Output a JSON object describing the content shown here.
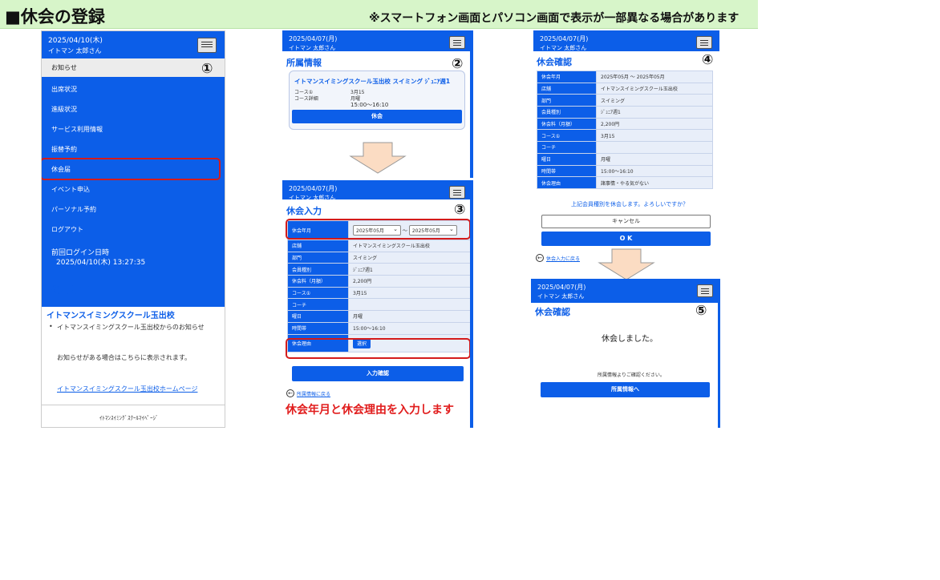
{
  "banner": {
    "title": "■休会の登録",
    "note": "※スマートフォン画面とパソコン画面で表示が一部異なる場合があります"
  },
  "panel1": {
    "date": "2025/04/10(木)",
    "user": "イトマン 太郎さん",
    "step": "①",
    "notice_row": "お知らせ",
    "menu": [
      "出席状況",
      "進級状況",
      "サービス利用情報",
      "振替予約",
      "休会届",
      "イベント申込",
      "パーソナル予約",
      "ログアウト"
    ],
    "last_login_label": "前回ログイン日時",
    "last_login_value": "2025/04/10(木)  13:27:35",
    "notice_heading": "お知らせ",
    "school_name": "イトマンスイミングスクール玉出校",
    "bullet": "イトマンスイミングスクール玉出校からのお知らせ",
    "info_text": "お知らせがある場合はこちらに表示されます。",
    "home_link": "イトマンスイミングスクール玉出校ホームページ",
    "footer": "ｲﾄﾏﾝｽｲﾐﾝｸﾞｽｸｰﾙﾏｲﾍﾟｰｼﾞ"
  },
  "panel2": {
    "date": "2025/04/07(月)",
    "user": "イトマン 太郎さん",
    "step": "②",
    "title": "所属情報",
    "card_title": "イトマンスイミングスクール玉出校  スイミング  ｼﾞｭﾆｱ週1",
    "course_label": "コース①",
    "course_value": "3月15",
    "sched_label": "コース詳細",
    "sched_day": "月曜",
    "sched_time": "15:00～16:10",
    "button": "休会"
  },
  "panel3": {
    "date": "2025/04/07(月)",
    "user": "イトマン 太郎さん",
    "step": "③",
    "title": "休会入力",
    "rows": [
      {
        "k": "休会年月",
        "v": ""
      },
      {
        "k": "店舗",
        "v": "イトマンスイミングスクール玉出校"
      },
      {
        "k": "部門",
        "v": "スイミング"
      },
      {
        "k": "会員種別",
        "v": "ｼﾞｭﾆｱ週1"
      },
      {
        "k": "休会料（月額）",
        "v": "2,200円"
      },
      {
        "k": "コース①",
        "v": "3月15"
      },
      {
        "k": "コーチ",
        "v": ""
      },
      {
        "k": "曜日",
        "v": "月曜"
      },
      {
        "k": "時間帯",
        "v": "15:00～16:10"
      },
      {
        "k": "休会理由",
        "v": ""
      }
    ],
    "from_select": "2025年05月",
    "range_sep": "～",
    "to_select": "2025年05月",
    "reason_button": "選択",
    "submit": "入力確認",
    "back": "所属情報に戻る",
    "red_note": "休会年月と休会理由を入力します"
  },
  "panel4": {
    "date": "2025/04/07(月)",
    "user": "イトマン 太郎さん",
    "step": "④",
    "title": "休会確認",
    "rows": [
      {
        "k": "休会年月",
        "v": "2025年05月 ～ 2025年05月"
      },
      {
        "k": "店舗",
        "v": "イトマンスイミングスクール玉出校"
      },
      {
        "k": "部門",
        "v": "スイミング"
      },
      {
        "k": "会員種別",
        "v": "ｼﾞｭﾆｱ週1"
      },
      {
        "k": "休会料（月額）",
        "v": "2,200円"
      },
      {
        "k": "コース①",
        "v": "3月15"
      },
      {
        "k": "コーチ",
        "v": ""
      },
      {
        "k": "曜日",
        "v": "月曜"
      },
      {
        "k": "時間帯",
        "v": "15:00～16:10"
      },
      {
        "k": "休会理由",
        "v": "諸事情・やる気がない"
      }
    ],
    "question": "上記会員種別を休会します。よろしいですか？",
    "cancel": "キャンセル",
    "ok": "O K",
    "back": "休会入力に戻る"
  },
  "panel5": {
    "date": "2025/04/07(月)",
    "user": "イトマン 太郎さん",
    "step": "⑤",
    "title": "休会確認",
    "done": "休会しました。",
    "hint": "所属情報よりご確認ください。",
    "button": "所属情報へ"
  },
  "colors": {
    "primary": "#0c5ee8",
    "accent_red": "#d41b1b",
    "banner": "#d7f5c9"
  }
}
